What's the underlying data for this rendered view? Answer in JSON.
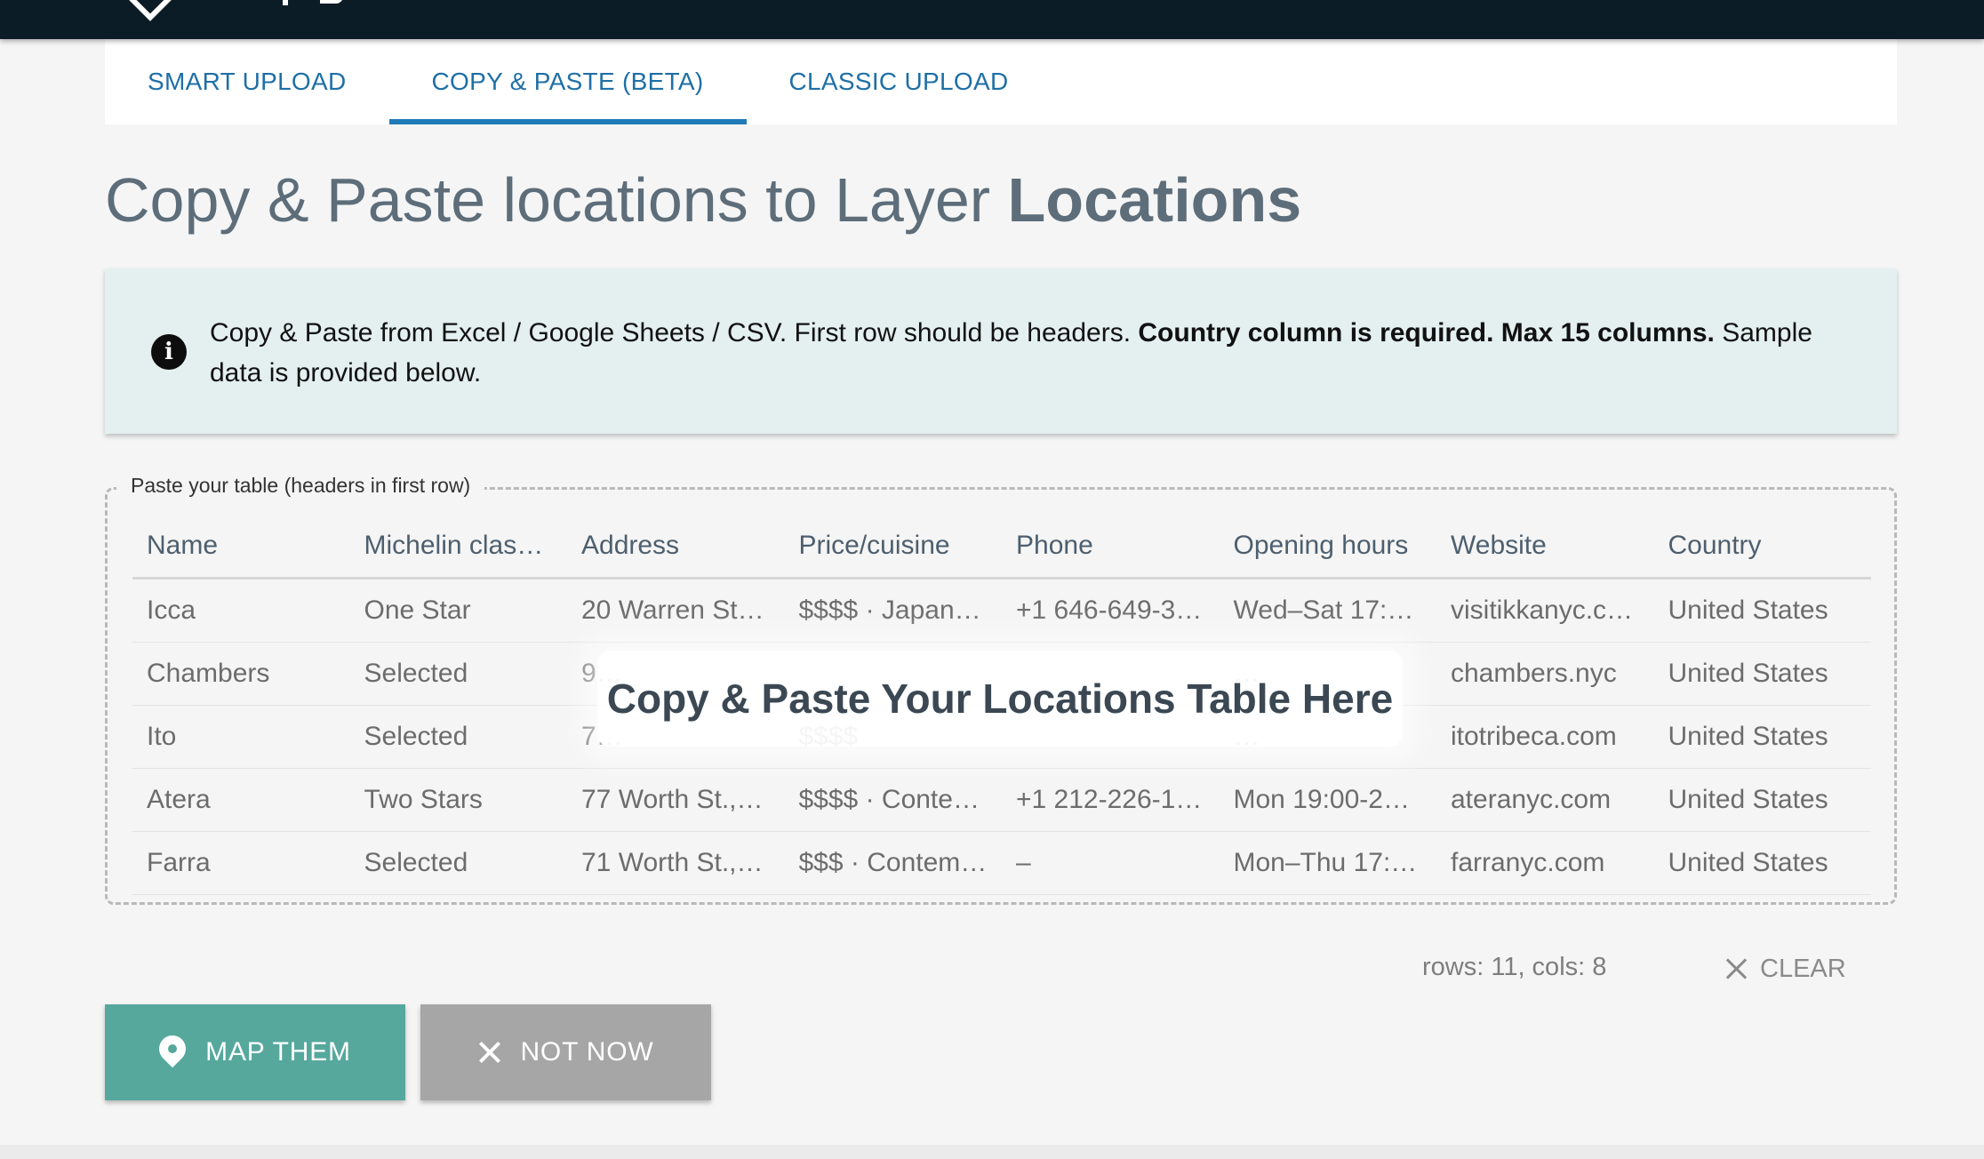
{
  "tabs": [
    {
      "label": "SMART UPLOAD",
      "active": false
    },
    {
      "label": "COPY & PASTE (BETA)",
      "active": true
    },
    {
      "label": "CLASSIC UPLOAD",
      "active": false
    }
  ],
  "page_title": {
    "prefix": "Copy & Paste locations to Layer ",
    "layer_name": "Locations"
  },
  "info": {
    "icon": "info-icon",
    "text_start": "Copy & Paste from Excel / Google Sheets / CSV. First row should be headers. ",
    "text_bold": "Country column is required. Max 15 columns.",
    "text_end": " Sample data is provided below."
  },
  "paste_area": {
    "legend": "Paste your table (headers in first row)",
    "overlay_label": "Copy & Paste Your Locations Table Here"
  },
  "table": {
    "headers": [
      "Name",
      "Michelin class…",
      "Address",
      "Price/cuisine",
      "Phone",
      "Opening hours",
      "Website",
      "Country"
    ],
    "rows": [
      [
        "Icca",
        "One Star",
        "20 Warren St.,…",
        "$$$$ · Japane…",
        "+1 646-649-3…",
        "Wed–Sat 17:3…",
        "visitikkanyc.c…",
        "United States"
      ],
      [
        "Chambers",
        "Selected",
        "9…",
        "",
        "",
        "…",
        "chambers.nyc",
        "United States"
      ],
      [
        "Ito",
        "Selected",
        "7…",
        "$$$$",
        "",
        "…",
        "itotribeca.com",
        "United States"
      ],
      [
        "Atera",
        "Two Stars",
        "77 Worth St., …",
        "$$$$ · Conte…",
        "+1 212-226-1…",
        "Mon 19:00-22…",
        "ateranyc.com",
        "United States"
      ],
      [
        "Farra",
        "Selected",
        "71 Worth St., …",
        "$$$ · Contem…",
        "–",
        "Mon–Thu 17:…",
        "farranyc.com",
        "United States"
      ]
    ]
  },
  "stats": {
    "text": "rows: 11, cols: 8"
  },
  "actions": {
    "clear_label": "CLEAR",
    "map_label": "MAP THEM",
    "not_now_label": "NOT NOW"
  },
  "colors": {
    "topbar": "#0b1c26",
    "tab_text": "#1f6fa6",
    "tab_active_underline": "#1f7ab8",
    "info_bg": "#e3f0ef",
    "map_button": "#56a89d",
    "not_now_button": "#a6a6a6"
  }
}
